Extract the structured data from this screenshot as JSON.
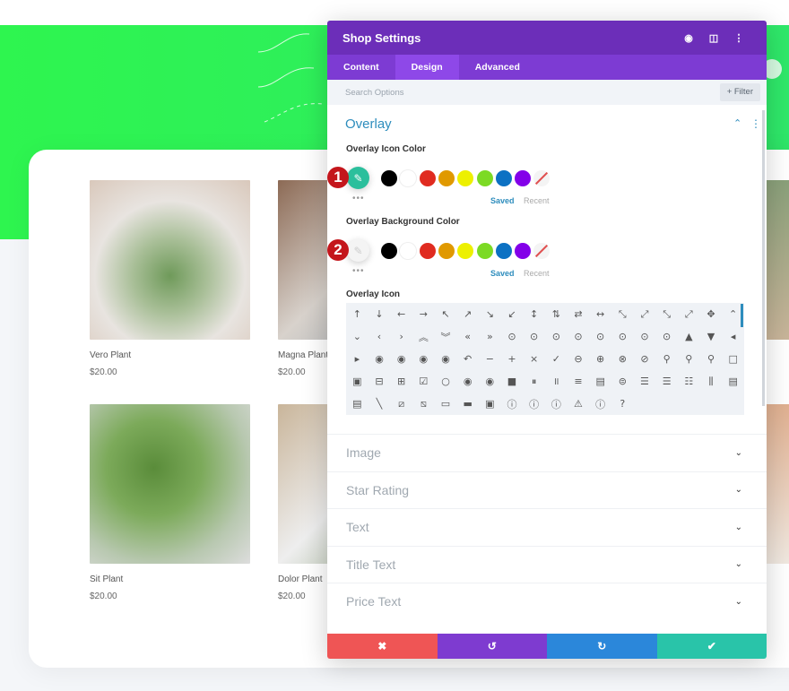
{
  "panel": {
    "title": "Shop Settings",
    "header_icons": [
      "focus-icon",
      "split-view-icon",
      "more-vertical-icon"
    ],
    "tabs": [
      {
        "label": "Content"
      },
      {
        "label": "Design",
        "active": true
      },
      {
        "label": "Advanced"
      }
    ],
    "search_placeholder": "Search Options",
    "filter_label": "+ Filter",
    "section": "Overlay",
    "icon_color": {
      "label": "Overlay Icon Color",
      "badge": "1",
      "selected": "#2bbf9c",
      "saved": "Saved",
      "recent": "Recent"
    },
    "bg_color": {
      "label": "Overlay Background Color",
      "badge": "2",
      "saved": "Saved",
      "recent": "Recent"
    },
    "swatches": [
      "#000000",
      "#ffffff",
      "#e02b20",
      "#e09900",
      "#edf000",
      "#7cda24",
      "#0c71c3",
      "#8300e9"
    ],
    "overlay_icon_label": "Overlay Icon",
    "icons": [
      "↑",
      "↓",
      "←",
      "→",
      "↖",
      "↗",
      "↘",
      "↙",
      "↕",
      "⇅",
      "⇄",
      "↔",
      "⤡",
      "⤢",
      "⤡",
      "⤢",
      "✥",
      "⌃",
      "⌄",
      "‹",
      "›",
      "︽",
      "︾",
      "«",
      "»",
      "⊙",
      "⊙",
      "⊙",
      "⊙",
      "⊙",
      "⊙",
      "⊙",
      "⊙",
      "▲",
      "▼",
      "◂",
      "▸",
      "◉",
      "◉",
      "◉",
      "◉",
      "↶",
      "−",
      "+",
      "×",
      "✓",
      "⊖",
      "⊕",
      "⊗",
      "⊘",
      "⚲",
      "⚲",
      "⚲",
      "□",
      "▣",
      "⊟",
      "⊞",
      "☑",
      "○",
      "◉",
      "◉",
      "■",
      "⏸",
      "॥",
      "≡",
      "▤",
      "⊜",
      "☰",
      "☰",
      "☷",
      "⫼",
      "▤",
      "▤",
      "╲",
      "⧄",
      "⧅",
      "▭",
      "▬",
      "▣",
      "ⓘ",
      "ⓘ",
      "ⓘ",
      "⚠",
      "ⓘ",
      "?"
    ],
    "sections": [
      "Image",
      "Star Rating",
      "Text",
      "Title Text",
      "Price Text"
    ],
    "actions": [
      {
        "name": "cancel",
        "icon": "✖",
        "color": "#ef5555"
      },
      {
        "name": "undo",
        "icon": "↺",
        "color": "#7e3bd0"
      },
      {
        "name": "redo",
        "icon": "↻",
        "color": "#2b87da"
      },
      {
        "name": "save",
        "icon": "✔",
        "color": "#29c4a9"
      }
    ]
  },
  "products": [
    {
      "title": "Vero Plant",
      "price": "$20.00"
    },
    {
      "title": "Magna Plant",
      "price": "$20.00"
    },
    {
      "title": "Sit Plant",
      "price": "$20.00"
    },
    {
      "title": "Dolor Plant",
      "price": "$20.00"
    }
  ]
}
